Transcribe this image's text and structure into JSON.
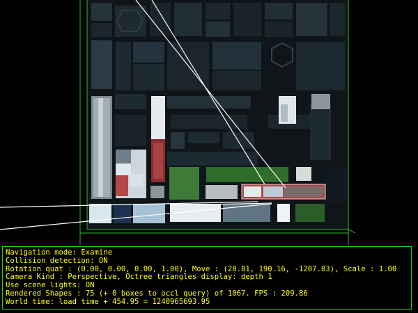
{
  "viewport": {
    "background": "#000000",
    "bbox_color": "#22c422",
    "ray_color": "#ffffff"
  },
  "status": {
    "text_color": "#ffff00",
    "border_color": "#1fd21f",
    "lines": [
      "Navigation mode: Examine",
      "Collision detection: ON",
      "Rotation quat : (0.00, 0.00, 0.00, 1.00), Move : (28.81, 190.16, -1207.83), Scale : 1.00",
      "Camera Kind : Perspective, Octree triangles display: depth 1",
      "Use scene lights: ON",
      "Rendered Shapes : 75 (+ 0 boxes to occl query) of 1067. FPS : 209.86",
      "World time: load time + 454.95 = 1240965693.95"
    ]
  }
}
